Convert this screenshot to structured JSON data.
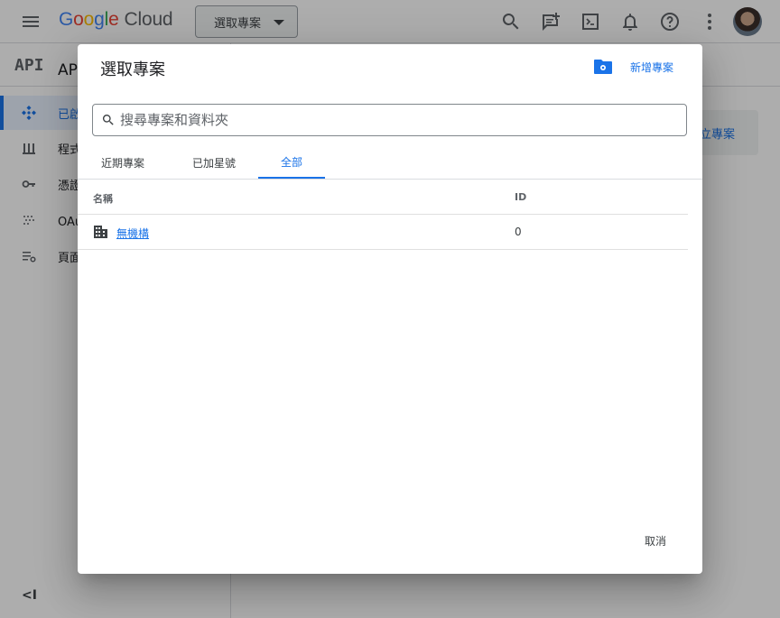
{
  "header": {
    "logo_google": "Google",
    "logo_cloud": "Cloud",
    "project_selector_label": "選取專案"
  },
  "sidebar": {
    "api_logo": "API",
    "title": "APIs 和服務",
    "items": [
      {
        "label": "已啟用的 API 和服務",
        "icon": "api-diamond-icon",
        "active": true
      },
      {
        "label": "程式庫",
        "icon": "library-icon"
      },
      {
        "label": "憑證",
        "icon": "key-icon"
      },
      {
        "label": "OAuth 同意畫面",
        "icon": "oauth-dots-icon"
      },
      {
        "label": "頁面使用協議",
        "icon": "settings-list-icon"
      }
    ]
  },
  "main": {
    "create_button_label": "建立專案"
  },
  "dialog": {
    "title": "選取專案",
    "new_project_label": "新增專案",
    "search_placeholder": "搜尋專案和資料夾",
    "tabs": [
      {
        "label": "近期專案",
        "active": false
      },
      {
        "label": "已加星號",
        "active": false
      },
      {
        "label": "全部",
        "active": true
      }
    ],
    "columns": {
      "name": "名稱",
      "id": "ID"
    },
    "rows": [
      {
        "name": "無機構",
        "id": "0",
        "icon": "organization-icon"
      }
    ],
    "cancel_label": "取消"
  },
  "colors": {
    "accent": "#1a73e8",
    "scrim": "rgba(0,0,0,0.32)"
  }
}
